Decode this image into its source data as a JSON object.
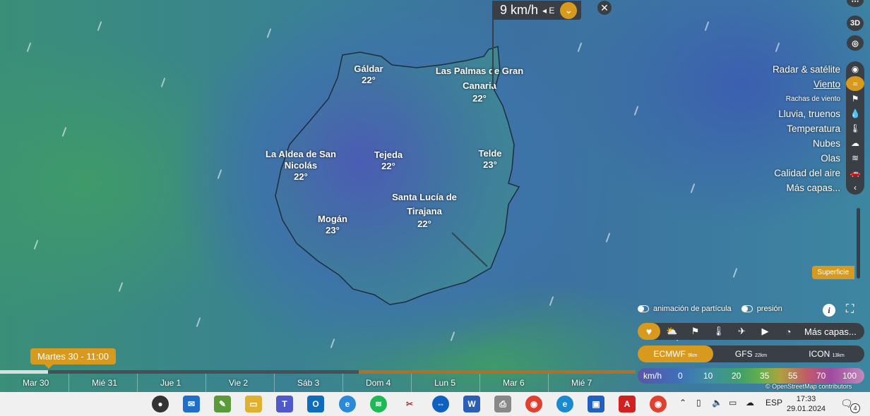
{
  "popup": {
    "value": "9 km/h",
    "direction": "◂ E"
  },
  "cities": [
    {
      "name": "Gáldar",
      "temp": "22°"
    },
    {
      "name": "Las Palmas de Gran Canaria",
      "temp": "22°"
    },
    {
      "name": "La Aldea de San Nicolás",
      "temp": "22°"
    },
    {
      "name": "Tejeda",
      "temp": "22°"
    },
    {
      "name": "Telde",
      "temp": "23°"
    },
    {
      "name": "Santa Lucía de Tirajana",
      "temp": "22°"
    },
    {
      "name": "Mogán",
      "temp": "23°"
    }
  ],
  "rail_top": {
    "btn_3d": "3D"
  },
  "menu": [
    {
      "label": "Radar & satélite"
    },
    {
      "label": "Viento"
    },
    {
      "label": "Rachas de viento"
    },
    {
      "label": "Lluvia, truenos"
    },
    {
      "label": "Temperatura"
    },
    {
      "label": "Nubes"
    },
    {
      "label": "Olas"
    },
    {
      "label": "Calidad del aire"
    },
    {
      "label": "Más capas..."
    }
  ],
  "superficie": "Superficie",
  "toggles": {
    "particles": "animación de partícula",
    "pressure": "presión"
  },
  "favorites_more": "Más capas...",
  "models": [
    {
      "name": "ECMWF",
      "res": "9km"
    },
    {
      "name": "GFS",
      "res": "22km"
    },
    {
      "name": "ICON",
      "res": "13km"
    }
  ],
  "legend": {
    "unit": "km/h",
    "ticks": [
      "0",
      "10",
      "20",
      "35",
      "55",
      "70",
      "100"
    ]
  },
  "attribution": "© OpenStreetMap contributors",
  "time_badge": "Martes 30 - 11:00",
  "days": [
    "Mar 30",
    "Mié 31",
    "Jue 1",
    "Vie 2",
    "Sáb 3",
    "Dom 4",
    "Lun 5",
    "Mar 6",
    "Mié 7"
  ],
  "taskbar": {
    "lang": "ESP",
    "time": "17:33",
    "date": "29.01.2024",
    "notifications": "4"
  },
  "colors": {
    "accent": "#d89a1e",
    "panel": "#3a3f45"
  }
}
